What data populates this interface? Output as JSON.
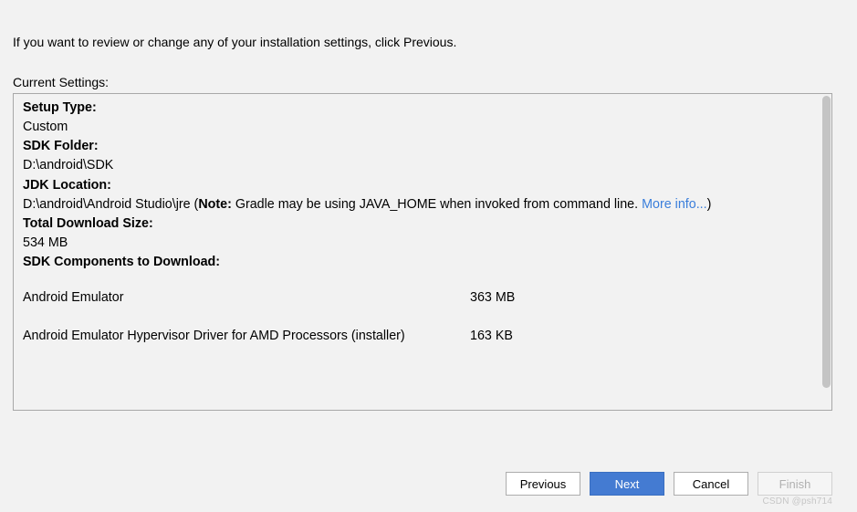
{
  "intro": "If you want to review or change any of your installation settings, click Previous.",
  "section_label": "Current Settings:",
  "settings": {
    "setup_type_label": "Setup Type:",
    "setup_type_value": "Custom",
    "sdk_folder_label": "SDK Folder:",
    "sdk_folder_value": "D:\\android\\SDK",
    "jdk_location_label": "JDK Location:",
    "jdk_location_value": "D:\\android\\Android Studio\\jre (",
    "jdk_note_bold": "Note:",
    "jdk_note_rest": " Gradle may be using JAVA_HOME when invoked from command line. ",
    "jdk_more_info": "More info...",
    "jdk_close_paren": ")",
    "total_download_label": "Total Download Size:",
    "total_download_value": "534 MB",
    "components_label": "SDK Components to Download:",
    "components": [
      {
        "name": "Android Emulator",
        "size": "363 MB"
      },
      {
        "name": "Android Emulator Hypervisor Driver for AMD Processors (installer)",
        "size": "163 KB"
      }
    ]
  },
  "buttons": {
    "previous": "Previous",
    "next": "Next",
    "cancel": "Cancel",
    "finish": "Finish"
  },
  "watermark": "CSDN @psh714"
}
